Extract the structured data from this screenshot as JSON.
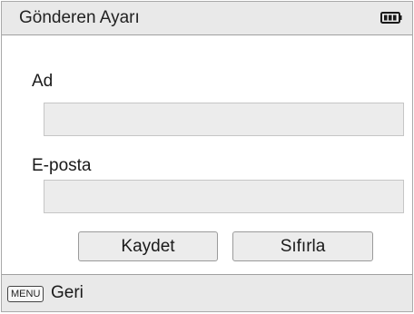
{
  "header": {
    "title": "Gönderen Ayarı",
    "battery_icon": "battery-full-icon"
  },
  "form": {
    "name_label": "Ad",
    "name_value": "",
    "email_label": "E-posta",
    "email_value": ""
  },
  "buttons": {
    "save_label": "Kaydet",
    "reset_label": "Sıfırla"
  },
  "footer": {
    "menu_key_label": "MENU",
    "back_label": "Geri"
  },
  "colors": {
    "bar_background": "#e9e9e9",
    "field_background": "#ececec",
    "border": "#a0a0a0"
  }
}
